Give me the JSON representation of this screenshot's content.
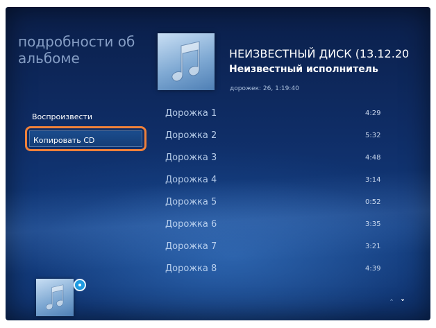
{
  "page": {
    "title": "подробности об альбоме"
  },
  "album": {
    "title": "НЕИЗВЕСТНЫЙ ДИСК (13.12.20",
    "artist": "Неизвестный исполнитель",
    "meta": "дорожек: 26, 1:19:40",
    "art_icon": "music-note-icon"
  },
  "actions": {
    "play_label": "Воспроизвести",
    "copy_label": "Копировать CD"
  },
  "highlight_color": "#f0813a",
  "tracks": [
    {
      "name": "Дорожка 1",
      "duration": "4:29"
    },
    {
      "name": "Дорожка 2",
      "duration": "5:32"
    },
    {
      "name": "Дорожка 3",
      "duration": "4:48"
    },
    {
      "name": "Дорожка 4",
      "duration": "3:14"
    },
    {
      "name": "Дорожка 5",
      "duration": "0:52"
    },
    {
      "name": "Дорожка 6",
      "duration": "3:35"
    },
    {
      "name": "Дорожка 7",
      "duration": "3:21"
    },
    {
      "name": "Дорожка 8",
      "duration": "4:39"
    }
  ],
  "scroll": {
    "up_glyph": "˄",
    "down_glyph": "˅"
  }
}
